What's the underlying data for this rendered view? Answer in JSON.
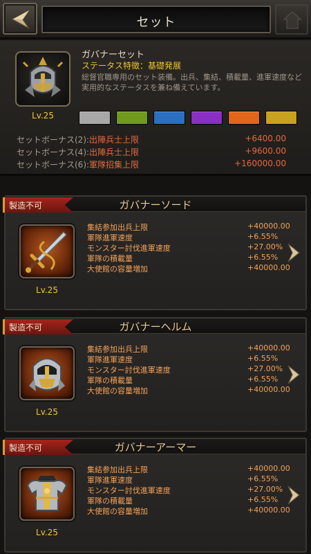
{
  "header": {
    "title": "セット"
  },
  "set": {
    "name": "ガバナーセット",
    "feature": "ステータス特徴：基礎発展",
    "description": "総督官職専用のセット装備。出兵、集結、積載量、進軍速度など実用的なステータスを兼ね備えています。",
    "level": "Lv.25",
    "quality_colors": [
      "#a8a8a8",
      "#6f9a1e",
      "#2a6fc0",
      "#8a2fc4",
      "#e0661b",
      "#c7a11f"
    ],
    "bonuses": [
      {
        "label": "セットボーナス(2):",
        "stat": "出陣兵士上限",
        "value": "+6400.00"
      },
      {
        "label": "セットボーナス(4):",
        "stat": "出陣兵士上限",
        "value": "+9600.00"
      },
      {
        "label": "セットボーナス(6):",
        "stat": "軍隊招集上限",
        "value": "+160000.00"
      }
    ]
  },
  "items": [
    {
      "status": "製造不可",
      "name": "ガバナーソード",
      "level": "Lv.25",
      "icon": "sword-icon",
      "stats": [
        {
          "name": "集結参加出兵上限",
          "value": "+40000.00"
        },
        {
          "name": "軍隊進軍速度",
          "value": "+6.55%"
        },
        {
          "name": "モンスター討伐進軍速度",
          "value": "+27.00%"
        },
        {
          "name": "軍隊の積載量",
          "value": "+6.55%"
        },
        {
          "name": "大使館の容量増加",
          "value": "+40000.00"
        }
      ]
    },
    {
      "status": "製造不可",
      "name": "ガバナーヘルム",
      "level": "Lv.25",
      "icon": "helmet-icon",
      "stats": [
        {
          "name": "集結参加出兵上限",
          "value": "+40000.00"
        },
        {
          "name": "軍隊進軍速度",
          "value": "+6.55%"
        },
        {
          "name": "モンスター討伐進軍速度",
          "value": "+27.00%"
        },
        {
          "name": "軍隊の積載量",
          "value": "+6.55%"
        },
        {
          "name": "大使館の容量増加",
          "value": "+40000.00"
        }
      ]
    },
    {
      "status": "製造不可",
      "name": "ガバナーアーマー",
      "level": "Lv.25",
      "icon": "armor-icon",
      "stats": [
        {
          "name": "集結参加出兵上限",
          "value": "+40000.00"
        },
        {
          "name": "軍隊進軍速度",
          "value": "+6.55%"
        },
        {
          "name": "モンスター討伐進軍速度",
          "value": "+27.00%"
        },
        {
          "name": "軍隊の積載量",
          "value": "+6.55%"
        },
        {
          "name": "大使館の容量増加",
          "value": "+40000.00"
        }
      ]
    }
  ]
}
